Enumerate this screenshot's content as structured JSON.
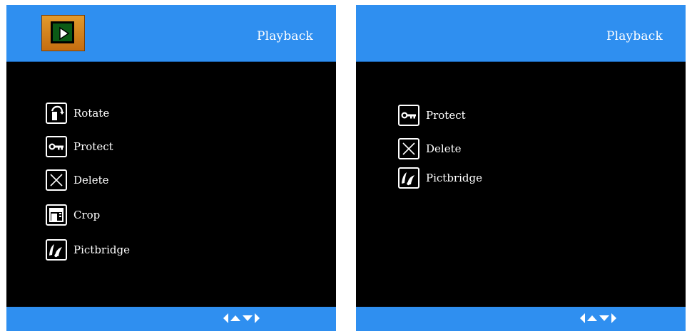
{
  "left_screen": {
    "title": "Playback",
    "mode_icon": "playback-mode-icon",
    "menu": [
      {
        "label": "Rotate",
        "icon": "rotate-icon"
      },
      {
        "label": "Protect",
        "icon": "key-icon"
      },
      {
        "label": "Delete",
        "icon": "delete-x-icon"
      },
      {
        "label": "Crop",
        "icon": "crop-icon"
      },
      {
        "label": "Pictbridge",
        "icon": "pictbridge-icon"
      }
    ],
    "nav_hint": [
      "left-arrow-icon",
      "up-arrow-icon",
      "down-arrow-icon",
      "right-arrow-icon"
    ]
  },
  "right_screen": {
    "title": "Playback",
    "menu": [
      {
        "label": "Protect",
        "icon": "key-icon"
      },
      {
        "label": "Delete",
        "icon": "delete-x-icon"
      },
      {
        "label": "Pictbridge",
        "icon": "pictbridge-icon"
      }
    ],
    "nav_hint": [
      "left-arrow-icon",
      "up-arrow-icon",
      "down-arrow-icon",
      "right-arrow-icon"
    ]
  },
  "colors": {
    "bar_blue": "#2f8ff0",
    "screen_bg": "#000000",
    "text": "#ffffff",
    "mode_icon_orange": "#e29a2c",
    "mode_icon_green": "#0b5a16"
  }
}
